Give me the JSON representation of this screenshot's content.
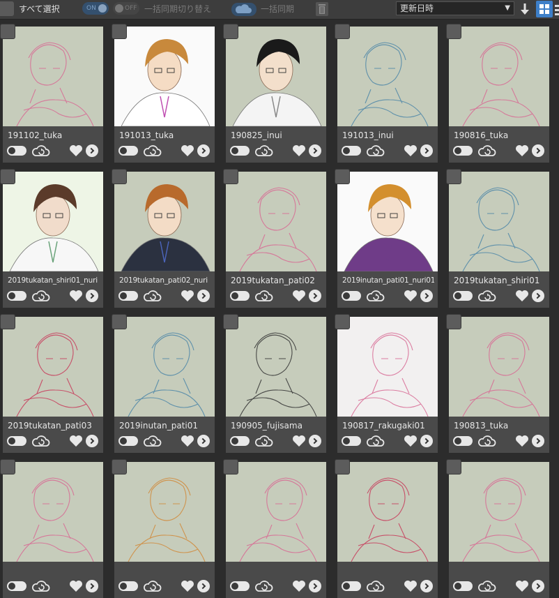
{
  "toolbar": {
    "select_all_label": "すべて選択",
    "on_label": "ON",
    "off_label": "OFF",
    "batch_sync_toggle_label": "一括同期切り替え",
    "batch_sync_label": "一括同期",
    "sort_selected": "更新日時",
    "accent_color": "#3d7fc8"
  },
  "cards": [
    {
      "title": "191102_tuka",
      "style": "sketch-pink"
    },
    {
      "title": "191013_tuka",
      "style": "color-orange"
    },
    {
      "title": "190825_inui",
      "style": "color-black"
    },
    {
      "title": "191013_inui",
      "style": "sketch-blue"
    },
    {
      "title": "190816_tuka",
      "style": "sketch-pink"
    },
    {
      "title": "2019tukatan_shiri01_nuri",
      "style": "color-duo"
    },
    {
      "title": "2019tukatan_pati02_nuri",
      "style": "color-coat"
    },
    {
      "title": "2019tukatan_pati02",
      "style": "sketch-pink"
    },
    {
      "title": "2019inutan_pati01_nuri01",
      "style": "color-purple"
    },
    {
      "title": "2019tukatan_shiri01",
      "style": "sketch-blue"
    },
    {
      "title": "2019tukatan_pati03",
      "style": "sketch-red"
    },
    {
      "title": "2019inutan_pati01",
      "style": "sketch-blue"
    },
    {
      "title": "190905_fujisama",
      "style": "sketch-black"
    },
    {
      "title": "190817_rakugaki01",
      "style": "sketch-pink"
    },
    {
      "title": "190813_tuka",
      "style": "sketch-pink"
    },
    {
      "title": "",
      "style": "sketch-pink"
    },
    {
      "title": "",
      "style": "sketch-orange"
    },
    {
      "title": "",
      "style": "sketch-pink"
    },
    {
      "title": "",
      "style": "sketch-red"
    },
    {
      "title": "",
      "style": "sketch-pink"
    }
  ],
  "icon_names": {
    "sync_toggle": "toggle-switch-icon",
    "cloud": "cloud-sync-icon",
    "favorite": "heart-icon",
    "open": "chevron-right-icon"
  }
}
